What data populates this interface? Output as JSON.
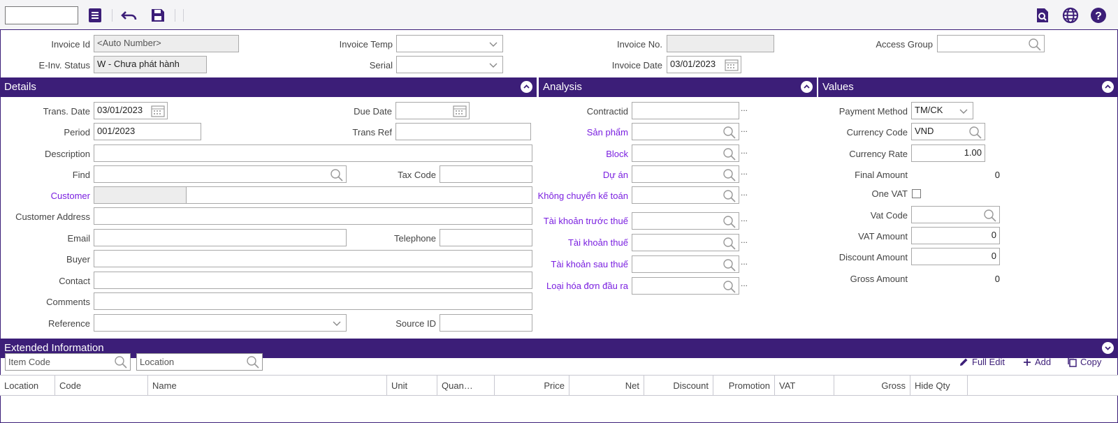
{
  "toolbar": {
    "search_value": "",
    "icons": [
      "list-icon",
      "undo-icon",
      "save-icon",
      "preview-icon",
      "globe-icon",
      "help-icon"
    ]
  },
  "header": {
    "invoice_id_label": "Invoice Id",
    "invoice_id_value": "<Auto Number>",
    "invoice_temp_label": "Invoice Temp",
    "invoice_temp_value": "",
    "invoice_no_label": "Invoice No.",
    "invoice_no_value": "",
    "access_group_label": "Access Group",
    "access_group_value": "",
    "einv_status_label": "E-Inv. Status",
    "einv_status_value": "W - Chưa phát hành",
    "serial_label": "Serial",
    "serial_value": "",
    "invoice_date_label": "Invoice Date",
    "invoice_date_value": "03/01/2023"
  },
  "sections": {
    "details": "Details",
    "analysis": "Analysis",
    "values": "Values",
    "extended": "Extended Information"
  },
  "details": {
    "trans_date_label": "Trans. Date",
    "trans_date_value": "03/01/2023",
    "due_date_label": "Due Date",
    "due_date_value": "",
    "period_label": "Period",
    "period_value": "001/2023",
    "trans_ref_label": "Trans Ref",
    "trans_ref_value": "",
    "description_label": "Description",
    "description_value": "",
    "find_label": "Find",
    "find_value": "",
    "tax_code_label": "Tax Code",
    "tax_code_value": "",
    "customer_label": "Customer",
    "customer_code_value": "",
    "customer_name_value": "",
    "customer_address_label": "Customer Address",
    "customer_address_value": "",
    "email_label": "Email",
    "email_value": "",
    "telephone_label": "Telephone",
    "telephone_value": "",
    "buyer_label": "Buyer",
    "buyer_value": "",
    "contact_label": "Contact",
    "contact_value": "",
    "comments_label": "Comments",
    "comments_value": "",
    "reference_label": "Reference",
    "reference_value": "",
    "source_id_label": "Source ID",
    "source_id_value": ""
  },
  "analysis": {
    "contractid_label": "Contractid",
    "san_pham_label": "Sản phẩm",
    "block_label": "Block",
    "du_an_label": "Dự án",
    "khong_chuyen_label": "Không chuyển kế toán",
    "tk_truoc_thue_label": "Tài khoản trước thuế",
    "tk_thue_label": "Tài khoản thuế",
    "tk_sau_thue_label": "Tài khoản sau thuế",
    "loai_hoa_don_label": "Loại hóa đơn đầu ra",
    "more": "..."
  },
  "values": {
    "payment_method_label": "Payment Method",
    "payment_method_value": "TM/CK",
    "currency_code_label": "Currency Code",
    "currency_code_value": "VND",
    "currency_rate_label": "Currency Rate",
    "currency_rate_value": "1.00",
    "final_amount_label": "Final Amount",
    "final_amount_value": "0",
    "one_vat_label": "One VAT",
    "one_vat_checked": false,
    "vat_code_label": "Vat Code",
    "vat_code_value": "",
    "vat_amount_label": "VAT Amount",
    "vat_amount_value": "0",
    "discount_amount_label": "Discount Amount",
    "discount_amount_value": "0",
    "gross_amount_label": "Gross Amount",
    "gross_amount_value": "0"
  },
  "grid": {
    "item_code_placeholder": "Item Code",
    "location_placeholder": "Location",
    "full_edit_label": "Full Edit",
    "add_label": "Add",
    "copy_label": "Copy",
    "columns": [
      "Location",
      "Code",
      "Name",
      "Unit",
      "Quan…",
      "Price",
      "Net",
      "Discount",
      "Promotion",
      "VAT",
      "Gross",
      "Hide Qty"
    ]
  },
  "colors": {
    "accent": "#3c1e78",
    "link": "#7a1fe0"
  }
}
